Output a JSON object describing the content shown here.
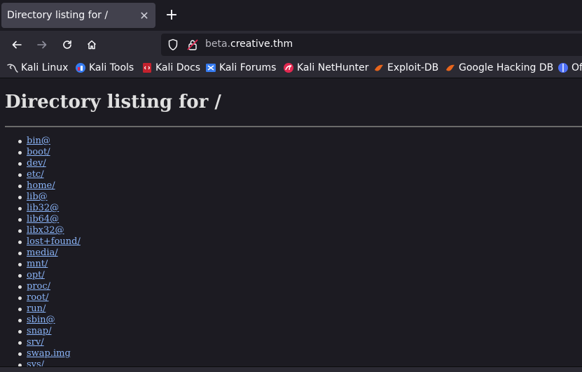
{
  "tab": {
    "title": "Directory listing for /",
    "close_glyph": "✕"
  },
  "newtab_glyph": "+",
  "url": {
    "subdomain": "beta.",
    "domain": "creative.thm"
  },
  "bookmarks": [
    {
      "label": "Kali Linux",
      "icon": "kali-dragon-icon"
    },
    {
      "label": "Kali Tools",
      "icon": "kali-tools-icon"
    },
    {
      "label": "Kali Docs",
      "icon": "kali-docs-icon"
    },
    {
      "label": "Kali Forums",
      "icon": "kali-forums-icon"
    },
    {
      "label": "Kali NetHunter",
      "icon": "kali-nethunter-icon"
    },
    {
      "label": "Exploit-DB",
      "icon": "exploit-db-icon"
    },
    {
      "label": "Google Hacking DB",
      "icon": "ghdb-icon"
    },
    {
      "label": "Of",
      "icon": "offsec-icon"
    }
  ],
  "page": {
    "heading": "Directory listing for /",
    "entries": [
      "bin@",
      "boot/",
      "dev/",
      "etc/",
      "home/",
      "lib@",
      "lib32@",
      "lib64@",
      "libx32@",
      "lost+found/",
      "media/",
      "mnt/",
      "opt/",
      "proc/",
      "root/",
      "run/",
      "sbin@",
      "snap/",
      "srv/",
      "swap.img",
      "sys/"
    ]
  },
  "colors": {
    "link": "#8ab4f8",
    "toolbar": "#2b2a33",
    "background": "#1c1b22"
  }
}
